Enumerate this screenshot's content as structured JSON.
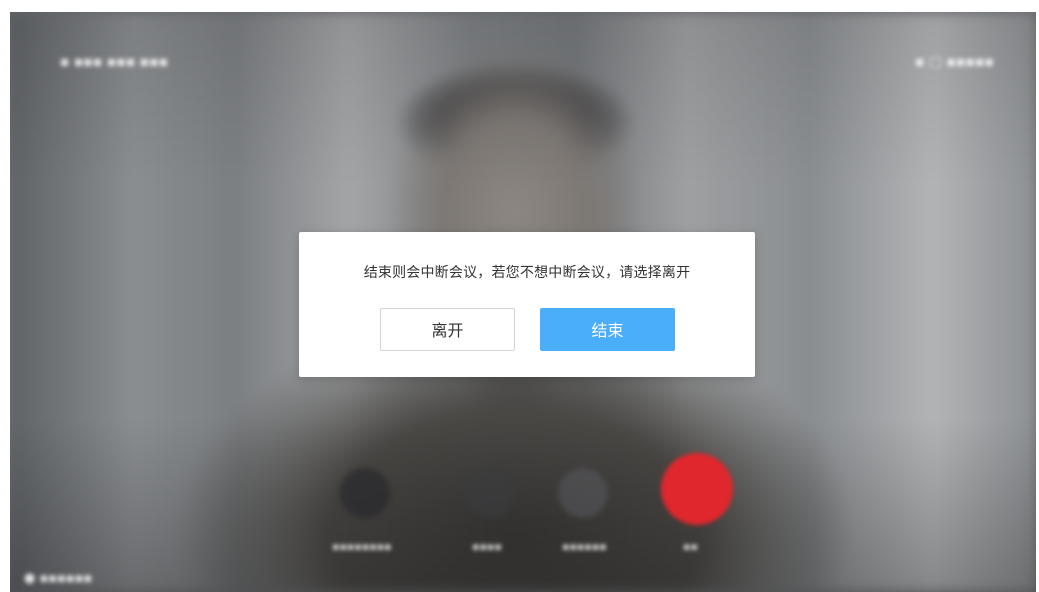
{
  "dialog": {
    "message": "结束则会中断会议，若您不想中断会议，请选择离开",
    "leave_label": "离开",
    "end_label": "结束"
  },
  "colors": {
    "primary": "#4aaefb",
    "end_call_red": "#e0272d",
    "dialog_bg": "#ffffff"
  },
  "background_icons": [
    "camera-icon",
    "mic-icon",
    "share-icon",
    "end-call-icon"
  ]
}
